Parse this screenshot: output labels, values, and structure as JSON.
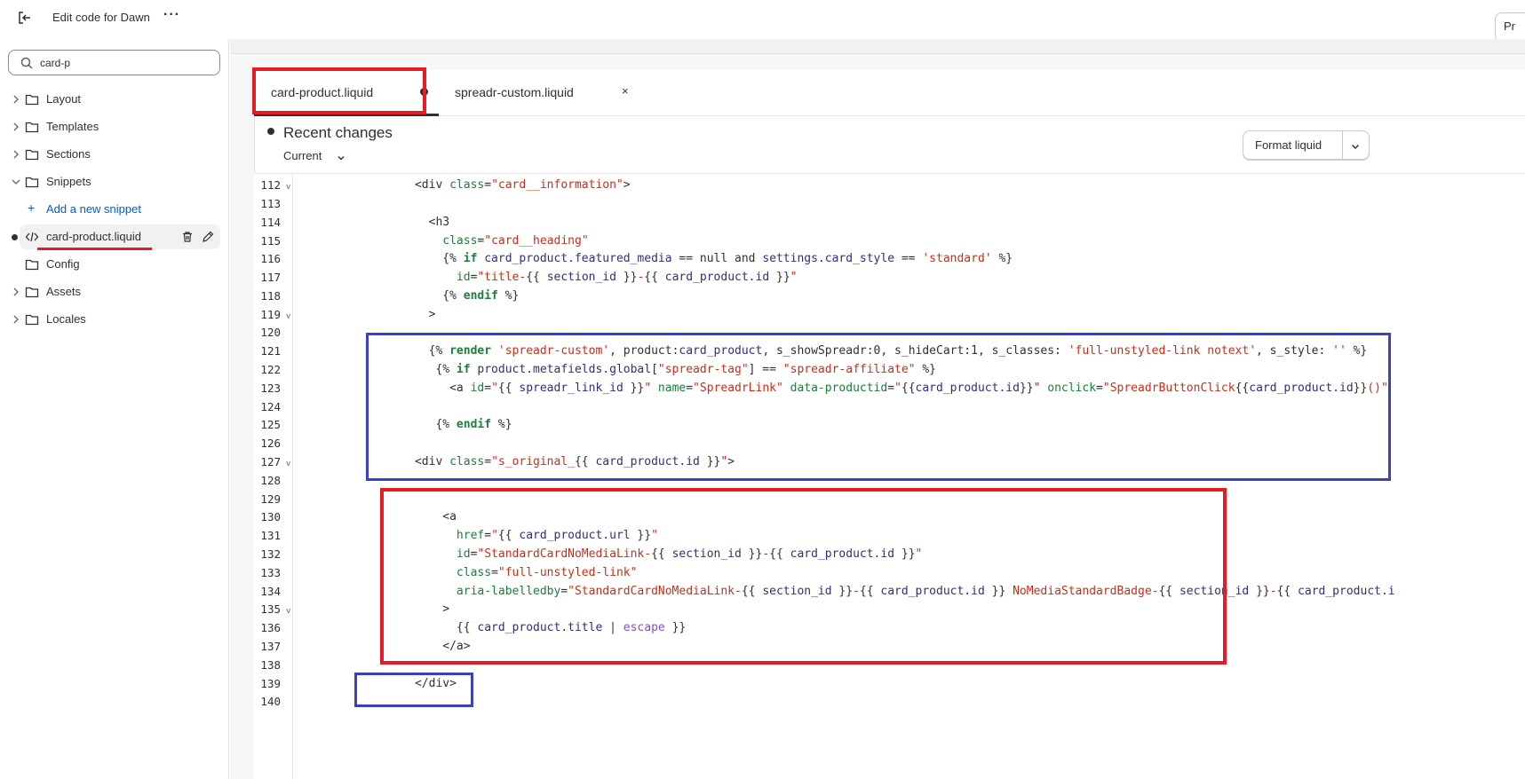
{
  "app": {
    "title": "Edit code for Dawn",
    "preview_label": "Pr"
  },
  "sidebar": {
    "search_value": "card-p",
    "items": [
      {
        "label": "Layout"
      },
      {
        "label": "Templates"
      },
      {
        "label": "Sections"
      },
      {
        "label": "Snippets"
      },
      {
        "label": "Add a new snippet"
      },
      {
        "label": "card-product.liquid"
      },
      {
        "label": "Config"
      },
      {
        "label": "Assets"
      },
      {
        "label": "Locales"
      }
    ]
  },
  "tabs": [
    {
      "label": "card-product.liquid",
      "modified": true
    },
    {
      "label": "spreadr-custom.liquid",
      "close": "×"
    }
  ],
  "header": {
    "recent_title": "Recent changes",
    "current_label": "Current",
    "format_button": "Format liquid"
  },
  "colors": {
    "annotation_red": "#e51c23",
    "annotation_blue": "#3c3fc4",
    "link_blue": "#005bd3"
  },
  "code": {
    "line_numbers": [
      "112",
      "113",
      "114",
      "115",
      "116",
      "117",
      "118",
      "119",
      "120",
      "121",
      "122",
      "123",
      "124",
      "125",
      "126",
      "127",
      "128",
      "129",
      "130",
      "131",
      "132",
      "133",
      "134",
      "135",
      "136",
      "137",
      "138",
      "139",
      "140"
    ]
  }
}
